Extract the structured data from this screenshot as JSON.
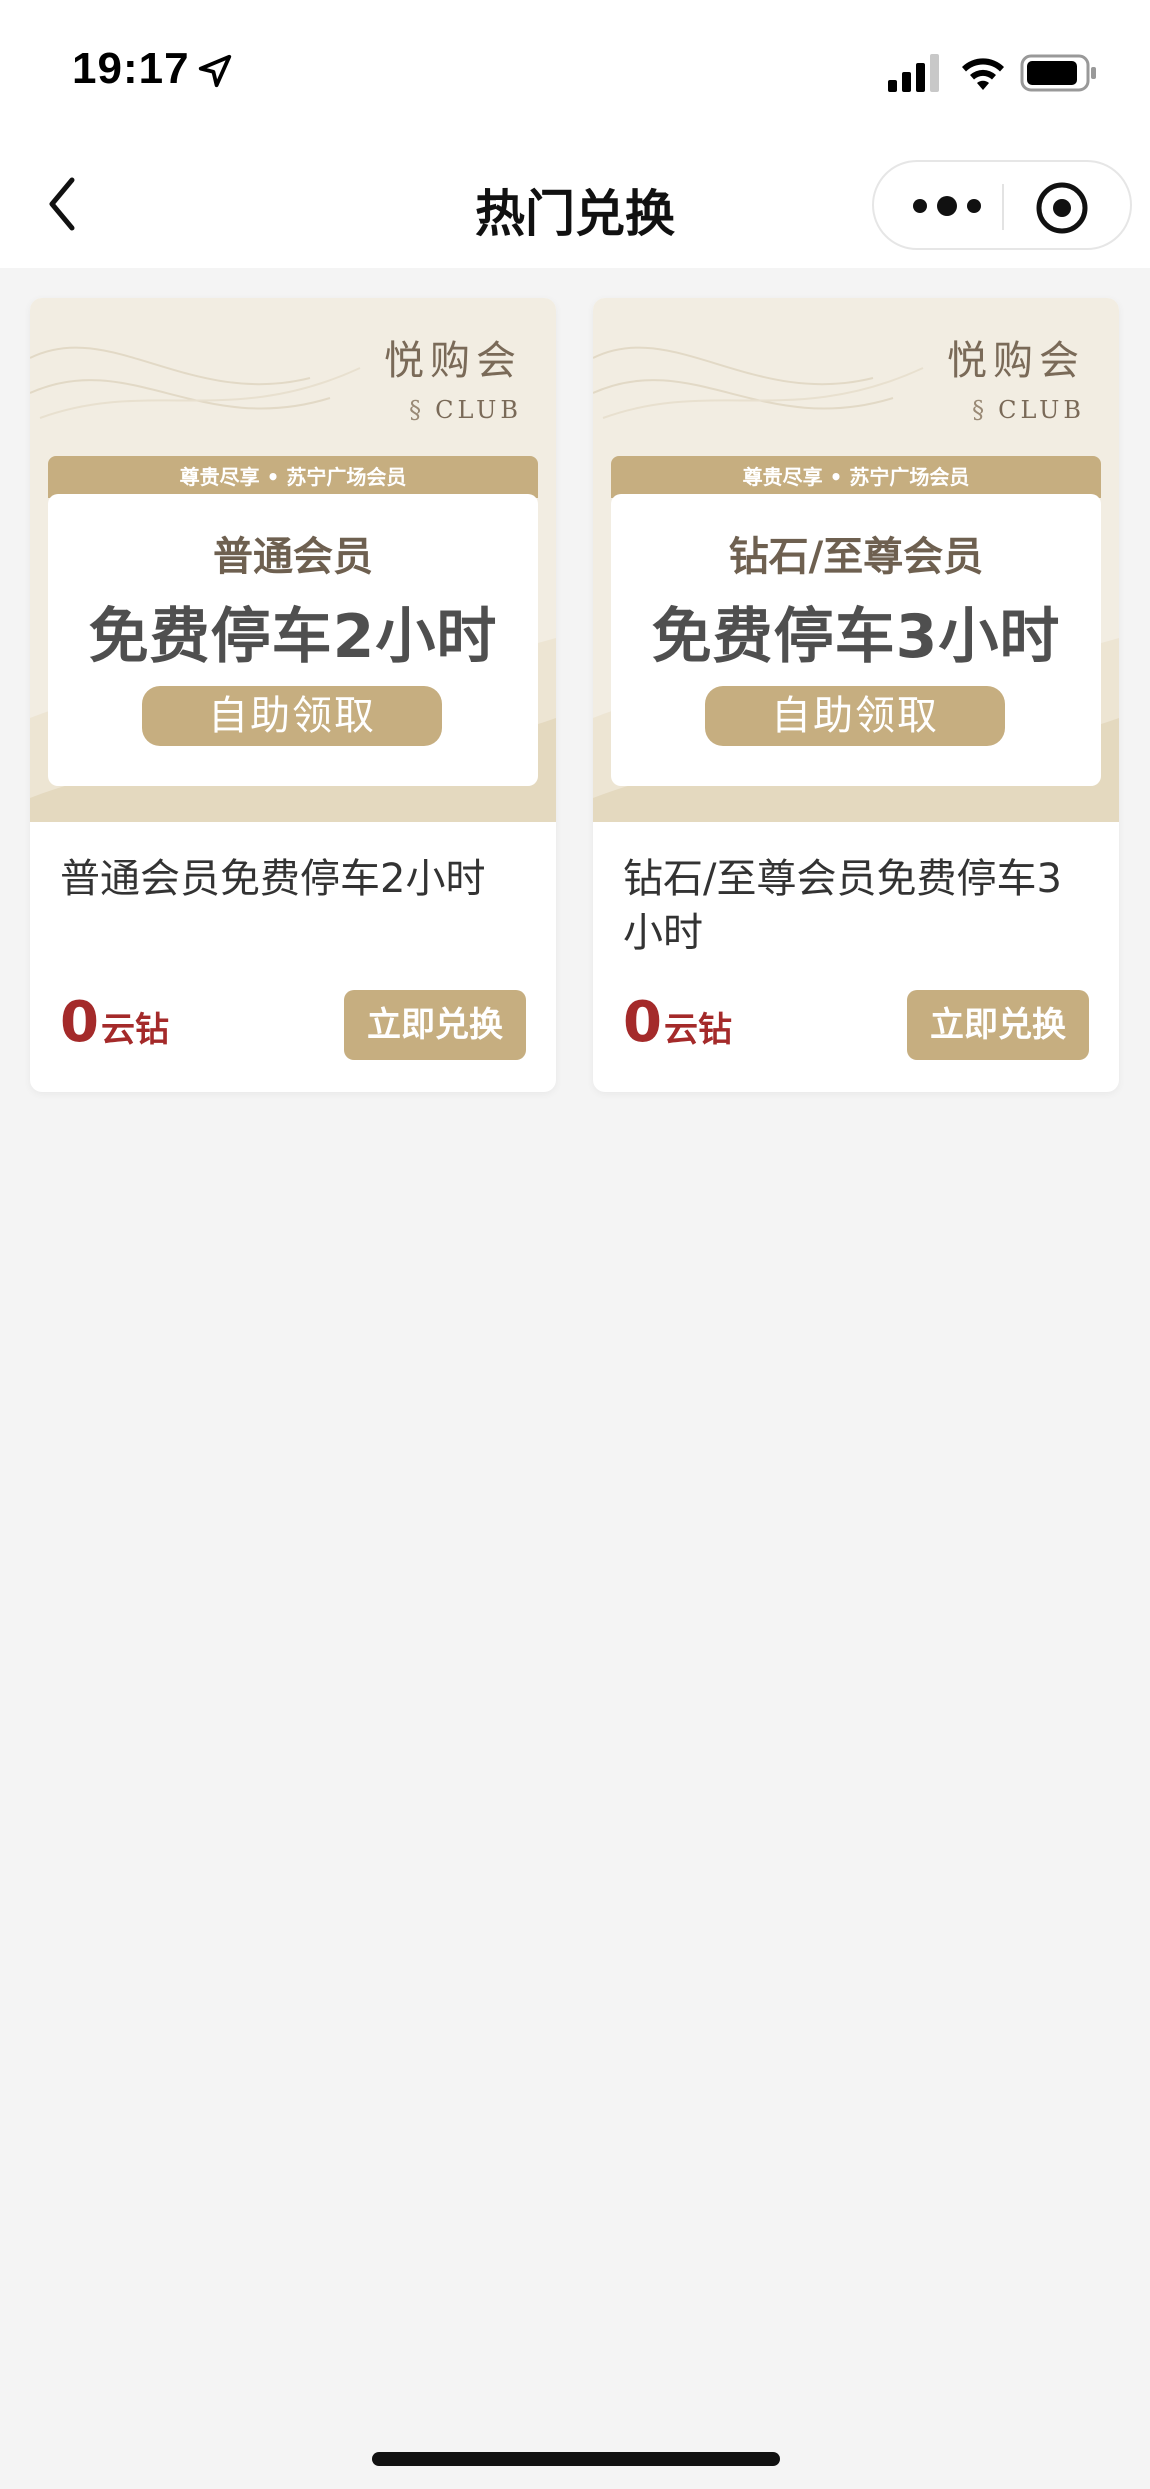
{
  "status_bar": {
    "time": "19:17",
    "icons": [
      "location-arrow-icon",
      "signal-icon",
      "wifi-icon",
      "battery-icon"
    ]
  },
  "nav": {
    "title": "热门兑换",
    "back_icon": "chevron-left-icon",
    "capsule_icons": [
      "more-dots-icon",
      "close-target-icon"
    ]
  },
  "colors": {
    "accent_gold": "#c6ae80",
    "price_red": "#a42a2a",
    "page_bg": "#f4f4f4"
  },
  "cards": [
    {
      "banner": {
        "brand": "悦购会",
        "brand_sub": "CLUB",
        "ribbon": "尊贵尽享 • 苏宁广场会员",
        "tier": "普通会员",
        "headline": "免费停车2小时",
        "action": "自助领取"
      },
      "title": "普通会员免费停车2小时",
      "price_value": "0",
      "price_unit": "云钻",
      "button": "立即兑换"
    },
    {
      "banner": {
        "brand": "悦购会",
        "brand_sub": "CLUB",
        "ribbon": "尊贵尽享 • 苏宁广场会员",
        "tier": "钻石/至尊会员",
        "headline": "免费停车3小时",
        "action": "自助领取"
      },
      "title": "钻石/至尊会员免费停车3小时",
      "price_value": "0",
      "price_unit": "云钻",
      "button": "立即兑换"
    }
  ]
}
